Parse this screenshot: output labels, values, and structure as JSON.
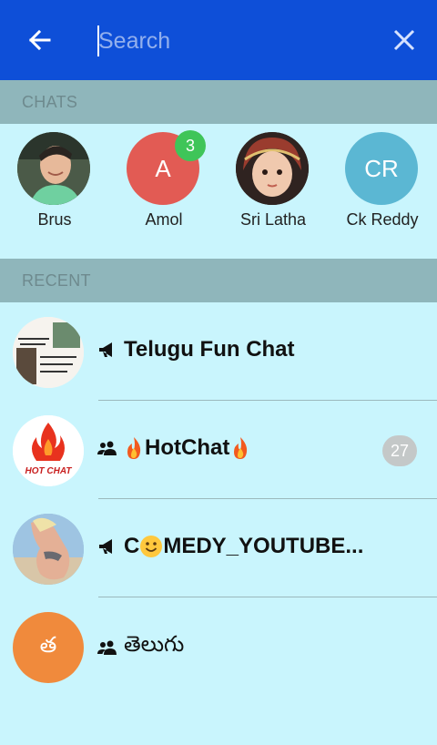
{
  "colors": {
    "primary": "#0e4fd8",
    "background": "#c9f5fd",
    "section": "#8fb6bb",
    "badge_green": "#3fc559",
    "count_gray": "#c4c8c8",
    "amol": "#e25b54",
    "ckreddy": "#5bb7d3",
    "telugu": "#f08a3c"
  },
  "appbar": {
    "back_icon": "arrow-left-icon",
    "search_placeholder": "Search",
    "close_icon": "close-icon"
  },
  "chats": {
    "header": "CHATS",
    "items": [
      {
        "name": "Brus",
        "avatar": "photo"
      },
      {
        "name": "Amol",
        "initials": "A",
        "badge": "3"
      },
      {
        "name": "Sri Latha",
        "avatar": "photo"
      },
      {
        "name": "Ck Reddy",
        "initials": "CR"
      }
    ]
  },
  "recent": {
    "header": "RECENT",
    "items": [
      {
        "title": "Telugu Fun Chat",
        "type_icon": "megaphone-icon"
      },
      {
        "title_main": "HotChat",
        "type_icon": "group-icon",
        "count": "27",
        "logo_text": "HOT CHAT"
      },
      {
        "title_pre": "C",
        "title_post": "MEDY_YOUTUBE...",
        "type_icon": "megaphone-icon"
      },
      {
        "title": "తెలుగు",
        "initial": "త",
        "type_icon": "group-icon"
      }
    ]
  }
}
